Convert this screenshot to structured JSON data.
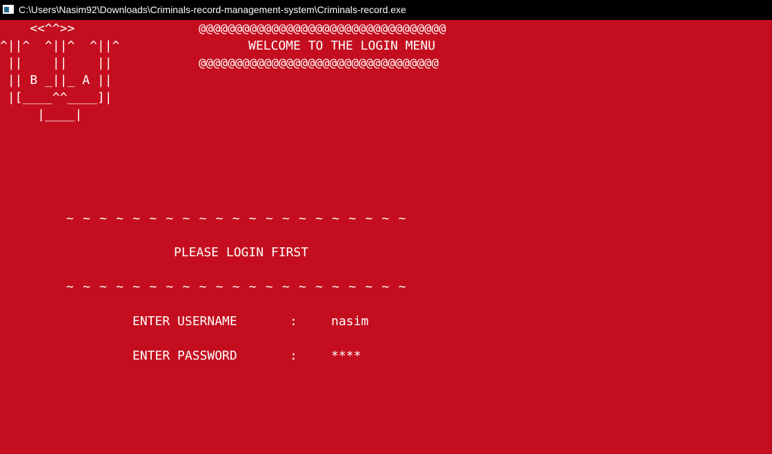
{
  "window": {
    "title": "C:\\Users\\Nasim92\\Downloads\\Criminals-record-management-system\\Criminals-record.exe",
    "icon": "console-app-icon"
  },
  "colors": {
    "background": "#c40e1f",
    "text": "#ffffff",
    "titlebar": "#000000"
  },
  "logo_ascii": [
    "    <<^^>>",
    "^||^  ^||^  ^||^",
    " ||    ||    ||",
    " || B _||_ A ||",
    " |[____^^____]|",
    "     |____|"
  ],
  "header": {
    "border_top": "@@@@@@@@@@@@@@@@@@@@@@@@@@@@@@@@@@",
    "title": "WELCOME TO THE LOGIN MENU",
    "border_bottom": "@@@@@@@@@@@@@@@@@@@@@@@@@@@@@@@@@"
  },
  "login": {
    "divider_top": "~ ~ ~ ~ ~ ~ ~ ~ ~ ~ ~ ~ ~ ~ ~ ~ ~ ~ ~ ~ ~",
    "prompt": "PLEASE LOGIN FIRST",
    "divider_bottom": "~ ~ ~ ~ ~ ~ ~ ~ ~ ~ ~ ~ ~ ~ ~ ~ ~ ~ ~ ~ ~",
    "username_label": "ENTER USERNAME",
    "username_sep": ":",
    "username_value": "nasim",
    "password_label": "ENTER PASSWORD",
    "password_sep": ":",
    "password_value": "****"
  }
}
